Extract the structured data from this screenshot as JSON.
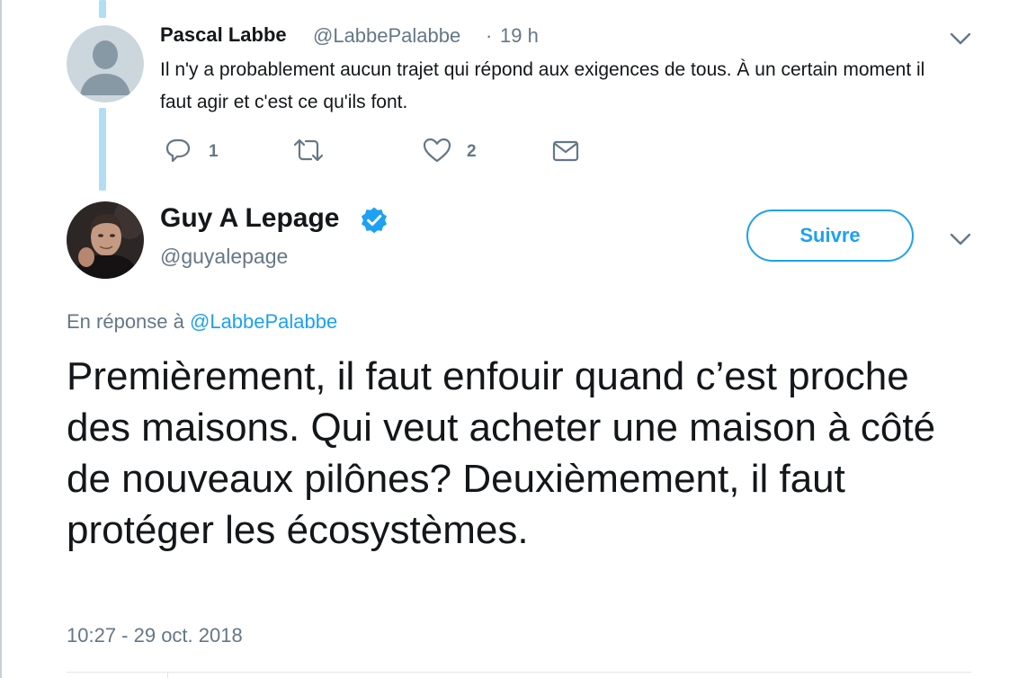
{
  "reply_tweet": {
    "display_name": "Pascal Labbe",
    "handle": "@LabbePalabbe",
    "separator": "·",
    "time_ago": "19 h",
    "text": "Il n'y a probablement aucun trajet qui répond aux exigences de tous. À un certain moment il faut agir et c'est ce qu'ils font.",
    "avatar_icon": "default-user-icon",
    "actions": {
      "reply_count": "1",
      "retweet_count": "",
      "like_count": "2"
    }
  },
  "main_tweet": {
    "display_name": "Guy A Lepage",
    "handle": "@guyalepage",
    "verified_icon": "verified-badge-icon",
    "follow_label": "Suivre",
    "reply_to_prefix": "En réponse à",
    "reply_to_handle": "@LabbePalabbe",
    "text": "Premièrement, il faut enfouir quand c’est proche des maisons. Qui veut acheter une maison à côté de nouveaux pilônes? Deuxièmement, il faut protéger les écosystèmes.",
    "timestamp": "10:27 - 29 oct. 2018"
  },
  "colors": {
    "accent": "#1da1f2",
    "muted": "#657786",
    "text": "#14171a",
    "thread_line": "#b3dcf6"
  }
}
